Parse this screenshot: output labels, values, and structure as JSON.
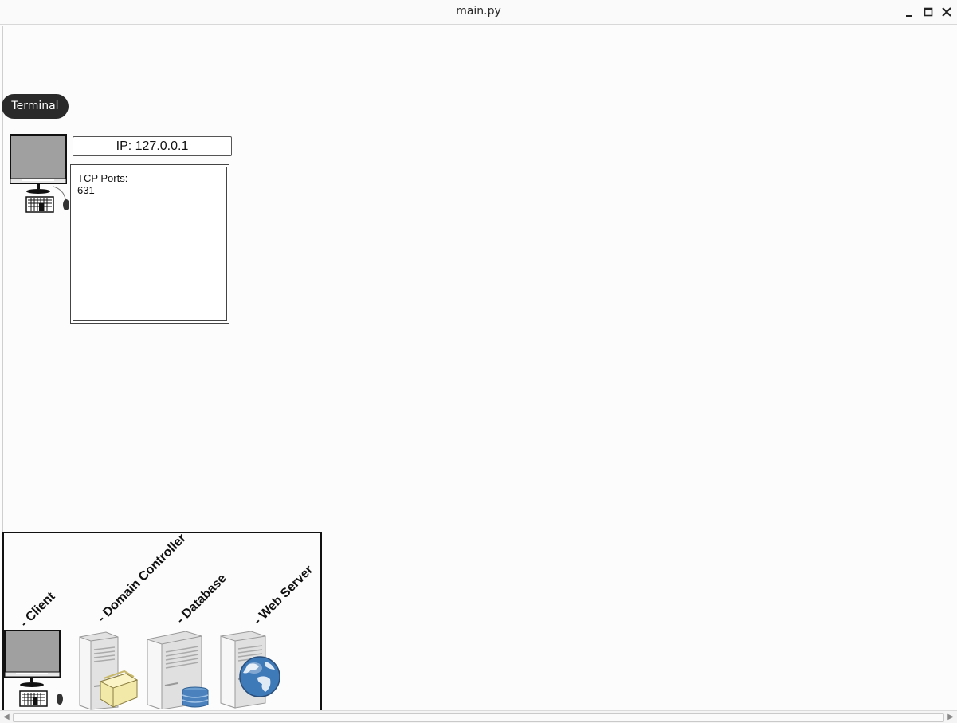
{
  "window": {
    "title": "main.py",
    "controls": [
      "minimize-icon",
      "maximize-icon",
      "close-icon"
    ]
  },
  "toolbar": {
    "terminal_label": "Terminal"
  },
  "selected_node": {
    "type": "Client",
    "ip_label": "IP: 127.0.0.1",
    "ports_title": "TCP Ports:",
    "ports": [
      "631"
    ]
  },
  "palette": {
    "items": [
      {
        "label": "- Client",
        "icon": "client-computer-icon"
      },
      {
        "label": "- Domain Controller",
        "icon": "domain-controller-server-icon"
      },
      {
        "label": "- Database",
        "icon": "database-server-icon"
      },
      {
        "label": "- Web Server",
        "icon": "web-server-icon"
      }
    ]
  },
  "colors": {
    "terminal_button": "#2a2a2a",
    "monitor_screen": "#a0a0a0",
    "canvas_bg": "#fcfcfc"
  }
}
